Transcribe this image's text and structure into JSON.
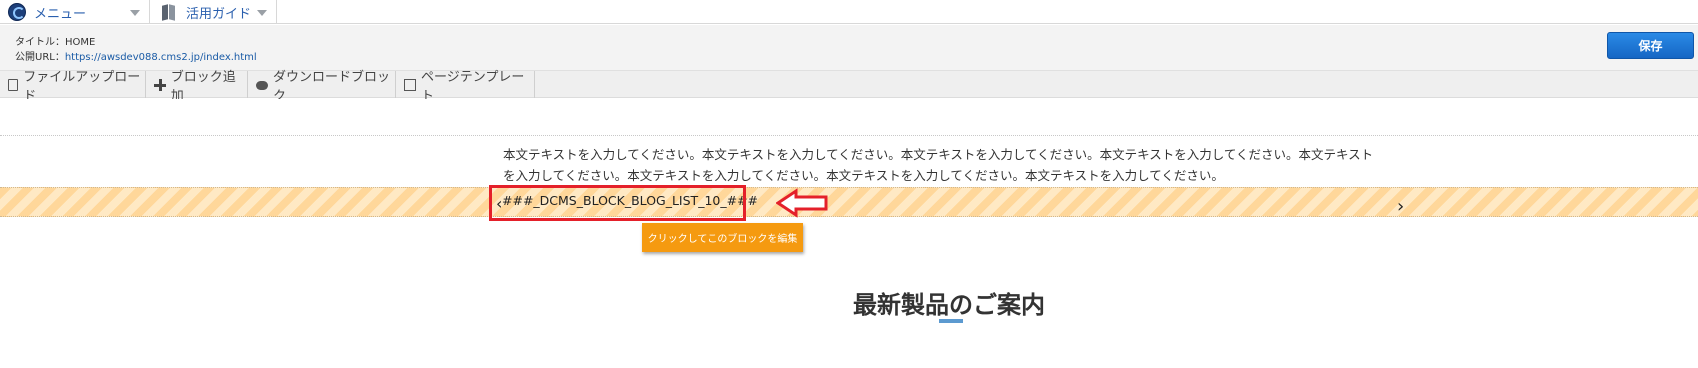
{
  "topbar": {
    "menu_label": "メニュー",
    "guide_label": "活用ガイド"
  },
  "info": {
    "title_label": "タイトル：HOME",
    "url_label": "公開URL：",
    "url_value": "https://awsdev088.cms2.jp/index.html",
    "save_label": "保存"
  },
  "toolbar": {
    "items": [
      {
        "label": "ファイルアップロード",
        "icon": "file-upload-icon"
      },
      {
        "label": "ブロック追加",
        "icon": "plus-icon"
      },
      {
        "label": "ダウンロードブロック",
        "icon": "cloud-download-icon"
      },
      {
        "label": "ページテンプレート",
        "icon": "template-icon"
      }
    ]
  },
  "content": {
    "body_line1": "本文テキストを入力してください。本文テキストを入力してください。本文テキストを入力してください。本文テキストを入力してください。本文テキスト",
    "body_line2": "を入力してください。本文テキストを入力してください。本文テキストを入力してください。本文テキストを入力してください。",
    "block_code": "###_DCMS_BLOCK_BLOG_LIST_10_###",
    "nav_prev": "‹",
    "nav_next": "›",
    "edit_tooltip": "クリックしてこのブロックを編集",
    "section_heading": "最新製品のご案内"
  },
  "colors": {
    "save_button": "#1a72d4",
    "highlight": "#e4202a",
    "tooltip": "#f59a10",
    "stripe": "#ffd79a",
    "heading_bar": "#5c9ad0"
  }
}
